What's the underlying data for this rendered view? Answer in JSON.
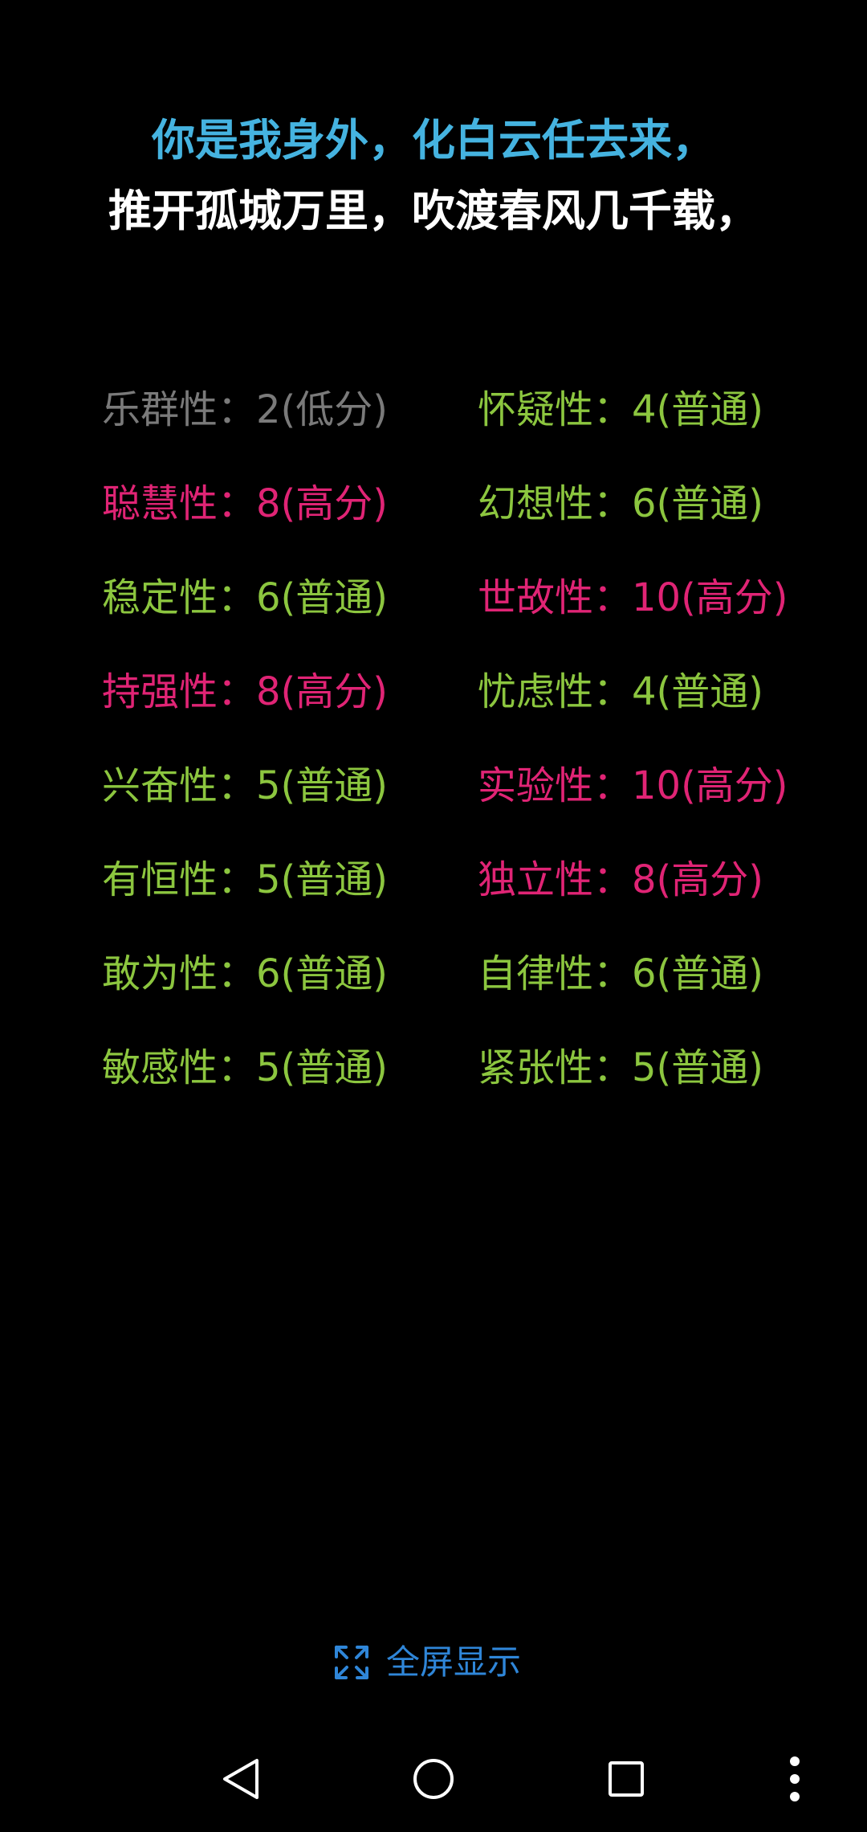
{
  "poem": {
    "line1": "你是我身外，化白云任去来，",
    "line2": "推开孤城万里，吹渡春风几千载，"
  },
  "colors": {
    "background": "#000000",
    "poem_line1": "#45b3e0",
    "poem_line2": "#ffffff",
    "low": "#7a7a7a",
    "normal": "#8cc63f",
    "high": "#e02475",
    "fullscreen": "#2f86d8",
    "nav": "#ffffff"
  },
  "traits": [
    {
      "text": "乐群性：2(低分)",
      "level": "low"
    },
    {
      "text": "怀疑性：4(普通)",
      "level": "normal"
    },
    {
      "text": "聪慧性：8(高分)",
      "level": "high"
    },
    {
      "text": "幻想性：6(普通)",
      "level": "normal"
    },
    {
      "text": "稳定性：6(普通)",
      "level": "normal"
    },
    {
      "text": "世故性：10(高分)",
      "level": "high"
    },
    {
      "text": "持强性：8(高分)",
      "level": "high"
    },
    {
      "text": "忧虑性：4(普通)",
      "level": "normal"
    },
    {
      "text": "兴奋性：5(普通)",
      "level": "normal"
    },
    {
      "text": "实验性：10(高分)",
      "level": "high"
    },
    {
      "text": "有恒性：5(普通)",
      "level": "normal"
    },
    {
      "text": "独立性：8(高分)",
      "level": "high"
    },
    {
      "text": "敢为性：6(普通)",
      "level": "normal"
    },
    {
      "text": "自律性：6(普通)",
      "level": "normal"
    },
    {
      "text": "敏感性：5(普通)",
      "level": "normal"
    },
    {
      "text": "紧张性：5(普通)",
      "level": "normal"
    }
  ],
  "fullscreen": {
    "label": "全屏显示",
    "icon": "expand-icon"
  },
  "navbar": {
    "icons": [
      "back-icon",
      "home-icon",
      "recents-icon",
      "more-icon"
    ]
  }
}
